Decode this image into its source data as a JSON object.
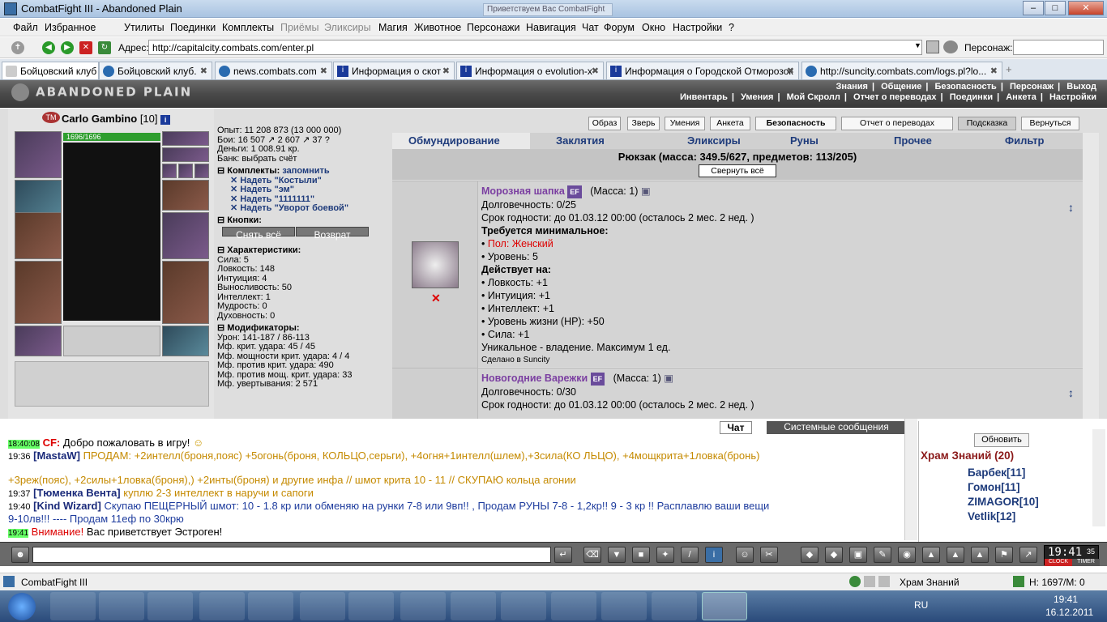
{
  "window": {
    "title": "CombatFight III - Abandoned Plain",
    "ghost_tab": "Приветствуем Вас CombatFight"
  },
  "menu": [
    "Файл",
    "Избранное",
    "Утилиты",
    "Поединки",
    "Комплекты",
    "Приёмы",
    "Эликсиры",
    "Магия",
    "Животное",
    "Персонажи",
    "Навигация",
    "Чат",
    "Форум",
    "Окно",
    "Настройки",
    "?"
  ],
  "address": {
    "label": "Адрес:",
    "url": "http://capitalcity.combats.com/enter.pl",
    "persona_label": "Персонаж:"
  },
  "tabs": [
    {
      "label": "Бойцовский клуб"
    },
    {
      "label": "Бойцовский клуб."
    },
    {
      "label": "news.combats.com"
    },
    {
      "label": "Информация о скот"
    },
    {
      "label": "Информация о evolution-x"
    },
    {
      "label": "Информация о Городской Отморозок"
    },
    {
      "label": "http://suncity.combats.com/logs.pl?lo..."
    }
  ],
  "game": {
    "logo": "ABANDONED PLAIN",
    "topnav1": [
      "Знания",
      "Общение",
      "Безопасность",
      "Персонаж",
      "Выход"
    ],
    "topnav2": [
      "Инвентарь",
      "Умения",
      "Мой Скролл",
      "Отчет о переводах",
      "Поединки",
      "Анкета",
      "Настройки"
    ],
    "char": {
      "name": "Carlo Gambino",
      "level": "[10]",
      "hp": "1696/1696"
    },
    "stats": {
      "exp": "Опыт: 11 208 873 (13 000 000)",
      "fights": "Бои: 16 507 ↗ 2 607 ↗ 37 ?",
      "money": "Деньги: 1 008.91 кр.",
      "bank": "Банк: выбрать счёт",
      "sets_title": "Комплекты:",
      "remember": "запомнить",
      "sets": [
        "Надеть \"Костыли\"",
        "Надеть \"эм\"",
        "Надеть \"1111111\"",
        "Надеть \"Уворот боевой\""
      ],
      "buttons_title": "Кнопки:",
      "btn_remove": "Снять всё",
      "btn_return": "Возврат",
      "char_title": "Характеристики:",
      "chars": [
        "Сила: 5",
        "Ловкость: 148",
        "Интуиция: 4",
        "Выносливость: 50",
        "Интеллект: 1",
        "Мудрость: 0",
        "Духовность: 0"
      ],
      "mod_title": "Модификаторы:",
      "mods": [
        "Урон: 141-187 / 86-113",
        "Мф. крит. удара: 45 / 45",
        "Мф. мощности крит. удара: 4 / 4",
        "Мф. против крит. удара: 490",
        "Мф. против мощ. крит. удара: 33",
        "Мф. увертывания: 2 571"
      ]
    },
    "toolbuttons": [
      "Образ",
      "Зверь",
      "Умения",
      "Анкета",
      "Безопасность",
      "Отчет о переводах",
      "Подсказка",
      "Вернуться"
    ],
    "inv_tabs": [
      "Обмундирование",
      "Заклятия",
      "Эликсиры",
      "Руны",
      "Прочее",
      "Фильтр"
    ],
    "backpack": "Рюкзак (масса: 349.5/627, предметов: 113/205)",
    "collapse": "Свернуть всё",
    "item1": {
      "name": "Морозная шапка",
      "badge": "EF",
      "mass": "(Масса: 1)",
      "lines": [
        "Долговечность: 0/25",
        "Срок годности: до 01.03.12 00:00 (осталось 2 мес. 2 нед. )"
      ],
      "req_title": "Требуется минимальное:",
      "req": [
        "Пол: Женский",
        "Уровень: 5"
      ],
      "acts_title": "Действует на:",
      "acts": [
        "Ловкость: +1",
        "Интуиция: +1",
        "Интеллект: +1",
        "Уровень жизни (HP): +50",
        "Сила: +1"
      ],
      "unique": "Уникальное - владение. Максимум 1 ед.",
      "made": "Сделано в Suncity"
    },
    "item2": {
      "name": "Новогодние Варежки",
      "badge": "EF",
      "mass": "(Масса: 1)",
      "lines": [
        "Долговечность: 0/30",
        "Срок годности: до 01.03.12 00:00 (осталось 2 мес. 2 нед. )"
      ]
    }
  },
  "chat": {
    "tab_chat": "Чат",
    "tab_sys": "Системные сообщения",
    "lines": [
      {
        "time": "18:40:08",
        "who": "CF:",
        "text": "Добро пожаловать в игру!"
      },
      {
        "time": "19:36",
        "who": "[MastaW]",
        "text": "ПРОДАМ: +2интелл(броня,пояс) +5огонь(броня, КОЛЬЦО,серьги), +4огня+1интелл(шлем),+3сила(КО ЛЬЦО), +4мощкрита+1ловка(бронь)"
      },
      {
        "time": "",
        "who": "",
        "text": "+3реж(пояс), +2силы+1ловка(броня),) +2инты(броня) и другие инфа // шмот крита 10 - 11 // СКУПАЮ кольца агонии"
      },
      {
        "time": "19:37",
        "who": "[Тюменка Вента]",
        "text": "куплю 2-3 интеллект в наручи и сапоги"
      },
      {
        "time": "19:40",
        "who": "[Kind Wizard]",
        "text": "Скупаю ПЕЩЕРНЫЙ шмот: 10 - 1.8 кр или обменяю на рунки 7-8 или 9вп!! , Продам РУНЫ 7-8 - 1,2кр!! 9 - 3 кр !! Расплавлю ваши вещи"
      },
      {
        "time": "",
        "who": "",
        "text": "9-10лв!!! ---- Продам 11еф по 30крю"
      },
      {
        "time": "19:41",
        "who": "Внимание!",
        "text": "Вас приветствует Эстроген!"
      }
    ],
    "refresh": "Обновить",
    "room": "Храм Знаний (20)",
    "users": [
      "Барбек[11]",
      "Гомон[11]",
      "ZIMAGOR[10]",
      "Vetlik[12]"
    ]
  },
  "clock": {
    "time": "19:41",
    "sec": "35",
    "clock_label": "CLOCK",
    "timer_label": "TIMER"
  },
  "status": {
    "app": "CombatFight III",
    "room": "Храм Знаний",
    "hp": "H: 1697/M: 0"
  },
  "taskbar": {
    "lang": "RU",
    "time": "19:41",
    "date": "16.12.2011"
  }
}
